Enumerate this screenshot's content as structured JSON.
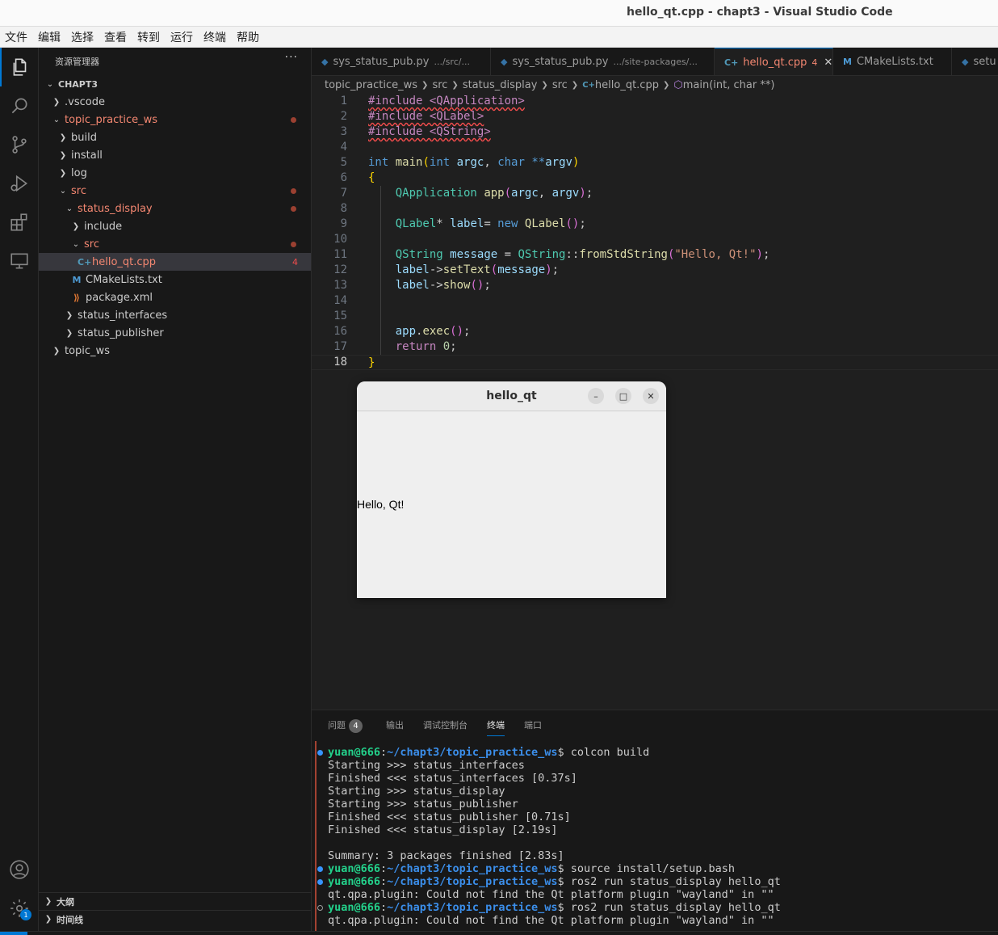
{
  "window": {
    "title": "hello_qt.cpp - chapt3 - Visual Studio Code"
  },
  "menubar": [
    "文件",
    "编辑",
    "选择",
    "查看",
    "转到",
    "运行",
    "终端",
    "帮助"
  ],
  "activity_bar": {
    "icons": [
      "files-icon",
      "search-icon",
      "source-control-icon",
      "run-debug-icon",
      "extensions-icon",
      "remote-explorer-icon"
    ],
    "bottom_icons": [
      "account-icon",
      "settings-gear-icon"
    ],
    "settings_badge": "1"
  },
  "sidebar": {
    "header": "资源管理器",
    "more": "···",
    "tree": [
      {
        "label": "CHAPT3",
        "chevron": "open",
        "depth": 0,
        "bold": true
      },
      {
        "label": ".vscode",
        "chevron": "closed",
        "depth": 1
      },
      {
        "label": "topic_practice_ws",
        "chevron": "open",
        "depth": 1,
        "error": true,
        "dot": true
      },
      {
        "label": "build",
        "chevron": "closed",
        "depth": 2
      },
      {
        "label": "install",
        "chevron": "closed",
        "depth": 2
      },
      {
        "label": "log",
        "chevron": "closed",
        "depth": 2
      },
      {
        "label": "src",
        "chevron": "open",
        "depth": 2,
        "error": true,
        "dot": true
      },
      {
        "label": "status_display",
        "chevron": "open",
        "depth": 3,
        "error": true,
        "dot": true
      },
      {
        "label": "include",
        "chevron": "closed",
        "depth": 4
      },
      {
        "label": "src",
        "chevron": "open",
        "depth": 4,
        "error": true,
        "dot": true
      },
      {
        "label": "hello_qt.cpp",
        "depth": 5,
        "error": true,
        "selected": true,
        "icon": "cpp",
        "count": "4"
      },
      {
        "label": "CMakeLists.txt",
        "depth": 4,
        "icon": "cmake"
      },
      {
        "label": "package.xml",
        "depth": 4,
        "icon": "xml"
      },
      {
        "label": "status_interfaces",
        "chevron": "closed",
        "depth": 3
      },
      {
        "label": "status_publisher",
        "chevron": "closed",
        "depth": 3
      },
      {
        "label": "topic_ws",
        "chevron": "closed",
        "depth": 1
      }
    ],
    "outline": "大纲",
    "timeline": "时间线"
  },
  "tabs": [
    {
      "label": "sys_status_pub.py",
      "desc": ".../src/...",
      "icon": "python"
    },
    {
      "label": "sys_status_pub.py",
      "desc": ".../site-packages/...",
      "icon": "python"
    },
    {
      "label": "hello_qt.cpp",
      "count": "4",
      "icon": "cpp",
      "active": true,
      "close": "✕"
    },
    {
      "label": "CMakeLists.txt",
      "icon": "cmake"
    },
    {
      "label": "setu",
      "icon": "python"
    }
  ],
  "breadcrumb": [
    "topic_practice_ws",
    "src",
    "status_display",
    "src",
    "hello_qt.cpp",
    "main(int, char **)"
  ],
  "editor": {
    "line_numbers": [
      "1",
      "2",
      "3",
      "4",
      "5",
      "6",
      "7",
      "8",
      "9",
      "10",
      "11",
      "12",
      "13",
      "14",
      "15",
      "16",
      "17",
      "18"
    ],
    "current_line": "18"
  },
  "qt_window": {
    "title": "hello_qt",
    "label": "Hello, Qt!",
    "buttons": [
      "–",
      "□",
      "✕"
    ]
  },
  "panel": {
    "tabs": [
      "问题",
      "输出",
      "调试控制台",
      "终端",
      "端口"
    ],
    "problems_count": "4",
    "active_tab": "终端",
    "prompt_user": "yuan@666",
    "prompt_path": "~/chapt3/topic_practice_ws",
    "terminal": [
      {
        "type": "prompt",
        "dot": "filled",
        "cmd": "colcon build"
      },
      {
        "type": "out",
        "text": "Starting >>> status_interfaces"
      },
      {
        "type": "out",
        "text": "Finished <<< status_interfaces [0.37s]"
      },
      {
        "type": "out",
        "text": "Starting >>> status_display"
      },
      {
        "type": "out",
        "text": "Starting >>> status_publisher"
      },
      {
        "type": "out",
        "text": "Finished <<< status_publisher [0.71s]"
      },
      {
        "type": "out",
        "text": "Finished <<< status_display [2.19s]"
      },
      {
        "type": "out",
        "text": ""
      },
      {
        "type": "out",
        "text": "Summary: 3 packages finished [2.83s]"
      },
      {
        "type": "prompt",
        "dot": "filled",
        "cmd": "source install/setup.bash"
      },
      {
        "type": "prompt",
        "dot": "filled",
        "cmd": "ros2 run status_display hello_qt"
      },
      {
        "type": "out",
        "text": "qt.qpa.plugin: Could not find the Qt platform plugin \"wayland\" in \"\""
      },
      {
        "type": "prompt",
        "dot": "empty",
        "cmd": "ros2 run status_display hello_qt"
      },
      {
        "type": "out",
        "text": "qt.qpa.plugin: Could not find the Qt platform plugin \"wayland\" in \"\""
      }
    ]
  },
  "colors": {
    "accent": "#0078d4",
    "error": "#f48771",
    "terminal_user": "#23d18b",
    "terminal_path": "#3b8eea"
  }
}
